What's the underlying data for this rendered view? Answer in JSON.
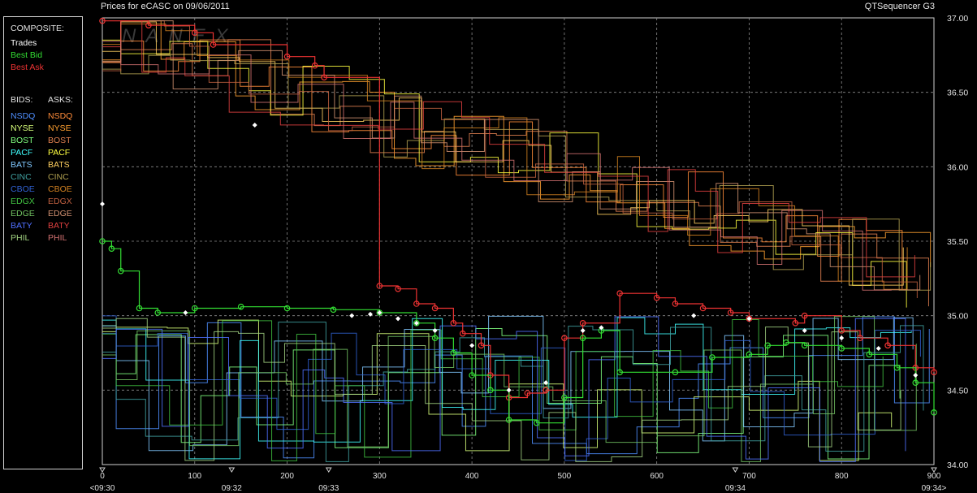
{
  "header": {
    "title_left": "Prices for  eCASC  on  09/06/2011",
    "title_right": "QTSequencer G3"
  },
  "legend": {
    "composite_label": "COMPOSITE:",
    "composite": [
      {
        "label": "Trades",
        "color": "#ffffff"
      },
      {
        "label": "Best Bid",
        "color": "#33dd33"
      },
      {
        "label": "Best Ask",
        "color": "#ee3333"
      }
    ],
    "bids_label": "BIDS:",
    "asks_label": "ASKS:",
    "exchanges": [
      {
        "bid": "NSDQ",
        "ask": "NSDQ",
        "bid_color": "#4f8fff",
        "ask_color": "#ff8c3a"
      },
      {
        "bid": "NYSE",
        "ask": "NYSE",
        "bid_color": "#d8ff7a",
        "ask_color": "#ffa030"
      },
      {
        "bid": "BOST",
        "ask": "BOST",
        "bid_color": "#80ff80",
        "ask_color": "#e08050"
      },
      {
        "bid": "PACF",
        "ask": "PACF",
        "bid_color": "#40ffff",
        "ask_color": "#ffff40"
      },
      {
        "bid": "BATS",
        "ask": "BATS",
        "bid_color": "#80c8ff",
        "ask_color": "#ffd060"
      },
      {
        "bid": "CINC",
        "ask": "CINC",
        "bid_color": "#40a0a0",
        "ask_color": "#b0a050"
      },
      {
        "bid": "CBOE",
        "ask": "CBOE",
        "bid_color": "#3060d0",
        "ask_color": "#d08020"
      },
      {
        "bid": "EDGX",
        "ask": "EDGX",
        "bid_color": "#40c040",
        "ask_color": "#c06040"
      },
      {
        "bid": "EDGE",
        "ask": "EDGE",
        "bid_color": "#70c060",
        "ask_color": "#d09070"
      },
      {
        "bid": "BATY",
        "ask": "BATY",
        "bid_color": "#5070ff",
        "ask_color": "#e04040"
      },
      {
        "bid": "PHIL",
        "ask": "PHIL",
        "bid_color": "#a0d080",
        "ask_color": "#d07070"
      }
    ]
  },
  "chart_data": {
    "type": "line",
    "watermark": "NANEX",
    "x_ticks": [
      0,
      100,
      200,
      300,
      400,
      500,
      600,
      700,
      800,
      900
    ],
    "xlim": [
      0,
      900
    ],
    "ylim": [
      34.0,
      37.0
    ],
    "y_ticks": [
      "34.00",
      "34.50",
      "35.00",
      "35.50",
      "36.00",
      "36.50",
      "37.00"
    ],
    "time_labels": [
      {
        "x": 0,
        "label": "<09:30"
      },
      {
        "x": 140,
        "label": "09:32"
      },
      {
        "x": 245,
        "label": "09:33"
      },
      {
        "x": 685,
        "label": "09:34"
      },
      {
        "x": 900,
        "label": "09:34>"
      }
    ],
    "grid": true,
    "series": [
      {
        "name": "Best Ask",
        "color": "#ee3333",
        "marker": "circle",
        "points": [
          [
            0,
            36.98
          ],
          [
            50,
            36.95
          ],
          [
            100,
            36.9
          ],
          [
            120,
            36.82
          ],
          [
            200,
            36.74
          ],
          [
            230,
            36.68
          ],
          [
            240,
            36.6
          ],
          [
            300,
            35.2
          ],
          [
            320,
            35.18
          ],
          [
            340,
            35.08
          ],
          [
            360,
            35.05
          ],
          [
            380,
            34.95
          ],
          [
            390,
            34.88
          ],
          [
            410,
            34.8
          ],
          [
            420,
            34.6
          ],
          [
            440,
            34.45
          ],
          [
            460,
            34.48
          ],
          [
            480,
            34.5
          ],
          [
            500,
            34.85
          ],
          [
            520,
            34.95
          ],
          [
            560,
            35.15
          ],
          [
            600,
            35.12
          ],
          [
            620,
            35.08
          ],
          [
            650,
            35.05
          ],
          [
            680,
            35.02
          ],
          [
            700,
            34.98
          ],
          [
            750,
            34.95
          ],
          [
            760,
            35.0
          ],
          [
            800,
            34.9
          ],
          [
            820,
            34.85
          ],
          [
            850,
            34.8
          ],
          [
            880,
            34.65
          ],
          [
            900,
            34.62
          ]
        ]
      },
      {
        "name": "Best Bid",
        "color": "#33dd33",
        "marker": "circle",
        "points": [
          [
            0,
            35.5
          ],
          [
            10,
            35.45
          ],
          [
            20,
            35.3
          ],
          [
            40,
            35.05
          ],
          [
            60,
            35.02
          ],
          [
            100,
            35.05
          ],
          [
            150,
            35.06
          ],
          [
            200,
            35.05
          ],
          [
            250,
            35.04
          ],
          [
            300,
            35.02
          ],
          [
            340,
            34.95
          ],
          [
            360,
            34.85
          ],
          [
            380,
            34.75
          ],
          [
            400,
            34.6
          ],
          [
            420,
            34.5
          ],
          [
            440,
            34.3
          ],
          [
            470,
            34.28
          ],
          [
            500,
            34.45
          ],
          [
            520,
            34.85
          ],
          [
            540,
            34.9
          ],
          [
            560,
            34.62
          ],
          [
            620,
            34.62
          ],
          [
            660,
            34.72
          ],
          [
            700,
            34.74
          ],
          [
            720,
            34.8
          ],
          [
            740,
            34.82
          ],
          [
            760,
            34.8
          ],
          [
            800,
            34.78
          ],
          [
            830,
            34.74
          ],
          [
            860,
            34.65
          ],
          [
            880,
            34.55
          ],
          [
            900,
            34.35
          ]
        ]
      },
      {
        "name": "Trades",
        "color": "#ffffff",
        "marker": "diamond",
        "points": [
          [
            0,
            35.75
          ],
          [
            90,
            35.02
          ],
          [
            165,
            36.28
          ],
          [
            270,
            35.0
          ],
          [
            290,
            35.01
          ],
          [
            300,
            35.02
          ],
          [
            320,
            34.98
          ],
          [
            340,
            34.95
          ],
          [
            360,
            34.9
          ],
          [
            400,
            34.8
          ],
          [
            440,
            34.5
          ],
          [
            480,
            34.55
          ],
          [
            520,
            34.9
          ],
          [
            540,
            34.92
          ],
          [
            640,
            35.0
          ],
          [
            700,
            34.98
          ],
          [
            760,
            34.9
          ],
          [
            800,
            34.85
          ],
          [
            840,
            34.78
          ],
          [
            880,
            34.6
          ]
        ]
      }
    ]
  }
}
